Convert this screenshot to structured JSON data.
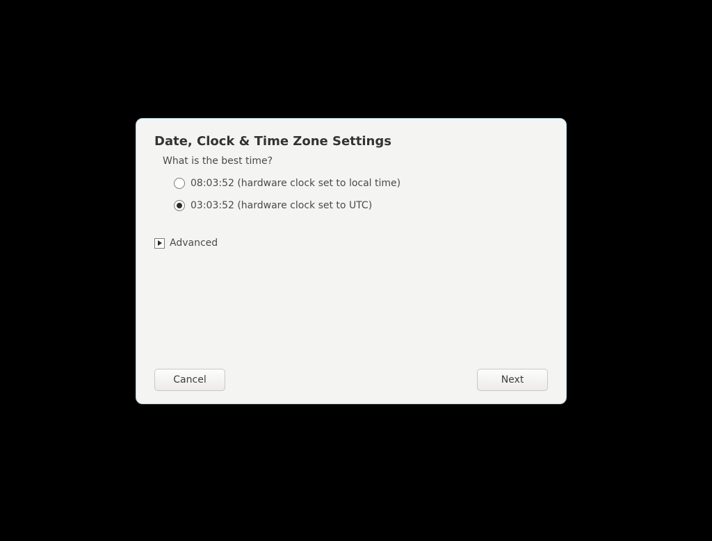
{
  "dialog": {
    "title": "Date, Clock & Time Zone Settings",
    "question": "What is the best time?",
    "options": [
      {
        "label": "08:03:52 (hardware clock set to local time)",
        "selected": false
      },
      {
        "label": "03:03:52 (hardware clock set to UTC)",
        "selected": true
      }
    ],
    "advanced_label": "Advanced",
    "buttons": {
      "cancel": "Cancel",
      "next": "Next"
    }
  }
}
